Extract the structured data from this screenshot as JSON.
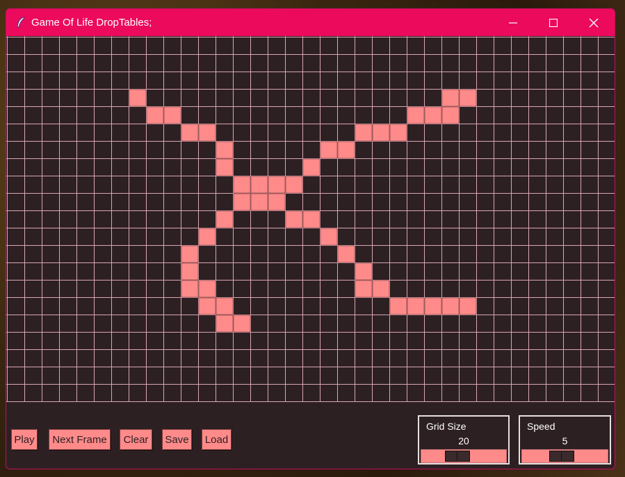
{
  "window": {
    "title": "Game Of Life DropTables;"
  },
  "colors": {
    "titlebar": "#ec0a5c",
    "background": "#2d2023",
    "grid_line": "#d9a7b3",
    "cell": "#ff8a8a",
    "cell_border": "#8a4a4a"
  },
  "grid": {
    "cols": 35,
    "rows": 21,
    "live_cells": [
      [
        7,
        3
      ],
      [
        25,
        3
      ],
      [
        26,
        3
      ],
      [
        8,
        4
      ],
      [
        9,
        4
      ],
      [
        23,
        4
      ],
      [
        24,
        4
      ],
      [
        25,
        4
      ],
      [
        10,
        5
      ],
      [
        11,
        5
      ],
      [
        20,
        5
      ],
      [
        21,
        5
      ],
      [
        22,
        5
      ],
      [
        12,
        6
      ],
      [
        18,
        6
      ],
      [
        19,
        6
      ],
      [
        12,
        7
      ],
      [
        17,
        7
      ],
      [
        13,
        8
      ],
      [
        14,
        8
      ],
      [
        15,
        8
      ],
      [
        16,
        8
      ],
      [
        13,
        9
      ],
      [
        14,
        9
      ],
      [
        15,
        9
      ],
      [
        12,
        10
      ],
      [
        16,
        10
      ],
      [
        17,
        10
      ],
      [
        11,
        11
      ],
      [
        18,
        11
      ],
      [
        10,
        12
      ],
      [
        19,
        12
      ],
      [
        10,
        13
      ],
      [
        20,
        13
      ],
      [
        10,
        14
      ],
      [
        11,
        14
      ],
      [
        20,
        14
      ],
      [
        21,
        14
      ],
      [
        11,
        15
      ],
      [
        12,
        15
      ],
      [
        22,
        15
      ],
      [
        23,
        15
      ],
      [
        24,
        15
      ],
      [
        25,
        15
      ],
      [
        26,
        15
      ],
      [
        12,
        16
      ],
      [
        13,
        16
      ]
    ]
  },
  "controls": {
    "play": "Play",
    "next_frame": "Next Frame",
    "clear": "Clear",
    "save": "Save",
    "load": "Load"
  },
  "sliders": {
    "grid_size": {
      "label": "Grid Size",
      "value": "20",
      "fraction": 0.4
    },
    "speed": {
      "label": "Speed",
      "value": "5",
      "fraction": 0.45
    }
  }
}
